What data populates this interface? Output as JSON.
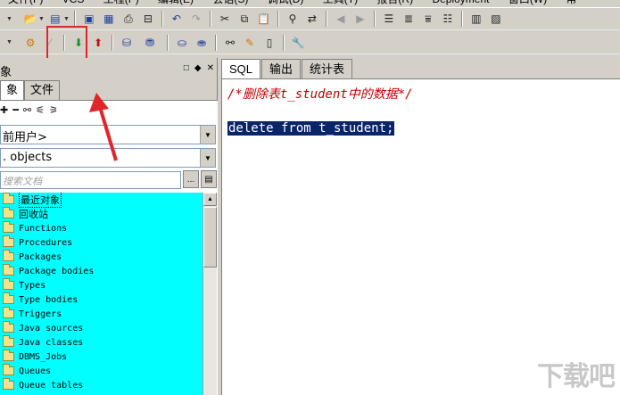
{
  "menubar": {
    "items": [
      "文件(F)",
      "VCS",
      "工程(P)",
      "编辑(E)",
      "会话(S)",
      "调试(D)",
      "工具(T)",
      "报告(R)",
      "Deployment",
      "窗口(W)",
      "帮"
    ]
  },
  "left_panel": {
    "title": "象",
    "tabs": [
      "象",
      "文件"
    ],
    "user_combo_value": "前用户>",
    "filter_combo_value": ". objects",
    "search_placeholder": "搜索文档",
    "browse_button": "...",
    "tree_items": [
      "最近对象",
      "回收站",
      "Functions",
      "Procedures",
      "Packages",
      "Package bodies",
      "Types",
      "Type bodies",
      "Triggers",
      "Java sources",
      "Java classes",
      "DBMS_Jobs",
      "Queues",
      "Queue tables"
    ]
  },
  "editor": {
    "tabs": [
      "SQL",
      "输出",
      "统计表"
    ],
    "lines": {
      "comment": "/*删除表t_student中的数据*/",
      "code": "delete from t_student;"
    }
  },
  "watermark": "下载吧",
  "colors": {
    "tree_background": "#00ffff",
    "selection": "#0a246a",
    "comment": "#c00000",
    "annotation": "#e0262a"
  }
}
